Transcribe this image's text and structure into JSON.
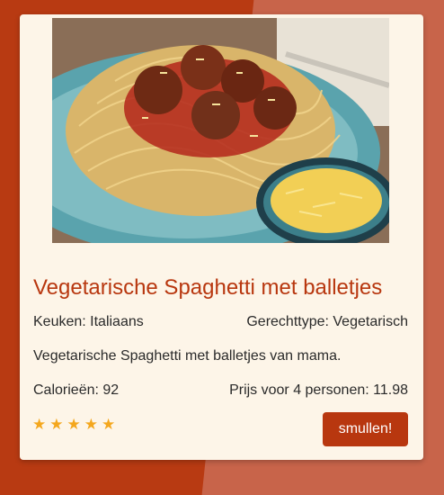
{
  "theme": {
    "accent": "#b8370f",
    "star": "#f4a71d",
    "card": "#fdf5e8",
    "page": "#b83a12"
  },
  "recipe": {
    "image_alt": "spaghetti-meatballs-photo",
    "title": "Vegetarische Spaghetti met balletjes",
    "cuisine": "Keuken: Italiaans",
    "dish_type": "Gerechttype: Vegetarisch",
    "description": "Vegetarische Spaghetti met balletjes van mama.",
    "calories": "Calorieën: 92",
    "price": "Prijs voor 4 personen: 11.98",
    "rating": 5,
    "rating_max": 5,
    "stars": [
      "★",
      "★",
      "★",
      "★",
      "★"
    ],
    "action_label": "smullen!"
  }
}
